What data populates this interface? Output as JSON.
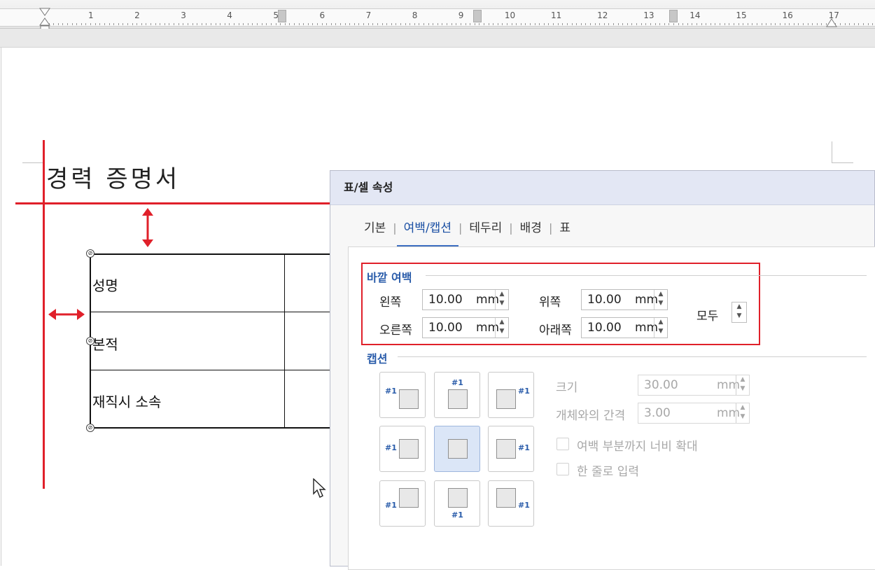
{
  "ruler": {
    "numbers": [
      "1",
      "2",
      "3",
      "4",
      "5",
      "6",
      "7",
      "8",
      "9",
      "10",
      "11",
      "12",
      "13",
      "14",
      "15",
      "16",
      "17"
    ]
  },
  "document": {
    "title": "경력 증명서",
    "rows": [
      "성명",
      "본적",
      "재직시 소속"
    ]
  },
  "dialog": {
    "title": "표/셀 속성",
    "tabs": [
      "기본",
      "여백/캡션",
      "테두리",
      "배경",
      "표"
    ],
    "active_tab": "여백/캡션",
    "outer_margin": {
      "group_label": "바깥 여백",
      "left_label": "왼쪽",
      "left_value": "10.00",
      "left_unit": "mm",
      "top_label": "위쪽",
      "top_value": "10.00",
      "top_unit": "mm",
      "right_label": "오른쪽",
      "right_value": "10.00",
      "right_unit": "mm",
      "bottom_label": "아래쪽",
      "bottom_value": "10.00",
      "bottom_unit": "mm",
      "all_label": "모두"
    },
    "caption": {
      "group_label": "캡션",
      "tag": "#1",
      "size_label": "크기",
      "size_value": "30.00",
      "size_unit": "mm",
      "gap_label": "개체와의 간격",
      "gap_value": "3.00",
      "gap_unit": "mm",
      "extend_label": "여백 부분까지 너비 확대",
      "single_line_label": "한 줄로 입력"
    }
  },
  "colors": {
    "accent_red": "#e0202a",
    "group_blue": "#2a5caa",
    "titlebar": "#e3e7f4"
  }
}
